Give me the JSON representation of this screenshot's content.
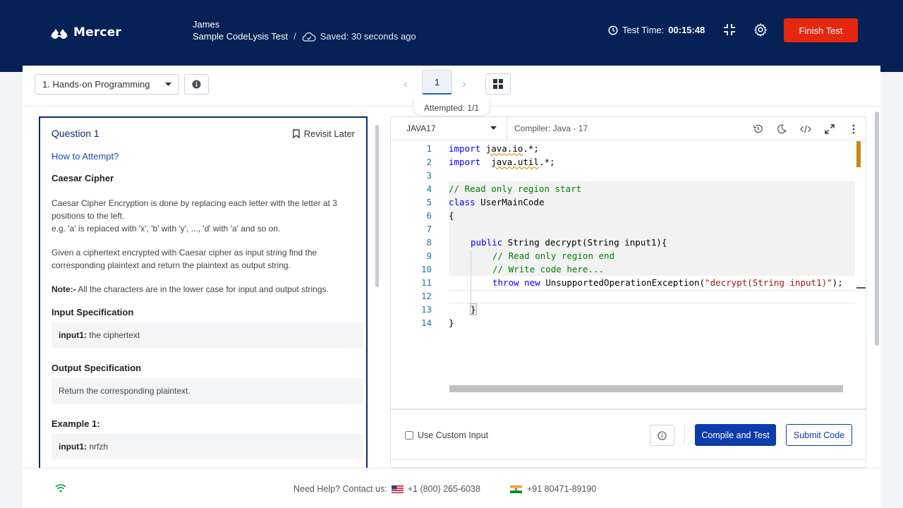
{
  "header": {
    "logo_text": "Mercer",
    "user_name": "James",
    "test_name": "Sample CodeLysis Test",
    "separator": "/",
    "saved_text": "Saved: 30 seconds ago",
    "timer_label": "Test Time:",
    "timer_value": "00:15:48",
    "finish_label": "Finish Test"
  },
  "navigation": {
    "section": "1. Hands-on Programming",
    "prev": "‹",
    "next": "›",
    "current_page": "1",
    "attempted": "Attempted: 1/1"
  },
  "question": {
    "title": "Question 1",
    "revisit_label": "Revisit Later",
    "how_to_attempt": "How to Attempt?",
    "name": "Caesar Cipher",
    "para1_line1": "Caesar Cipher Encryption is done by replacing each letter with the letter at 3 positions to the left.",
    "para1_line2": "e.g. 'a' is replaced with 'x', 'b' with 'y', ..., 'd' with 'a' and so on.",
    "para2": "Given a ciphertext encrypted with Caesar cipher as input string find the corresponding plaintext and return the plaintext as output string.",
    "note_label": "Note:-",
    "note_text": "  All the characters are in the lower case for input and output strings.",
    "input_spec_title": "Input Specification",
    "input_spec_key": "input1:",
    "input_spec_value": " the ciphertext",
    "output_spec_title": "Output Specification",
    "output_spec_value": "Return the corresponding plaintext.",
    "example_title": "Example 1:",
    "example_key": "input1:",
    "example_value": " nrfzh"
  },
  "editor": {
    "language": "JAVA17",
    "compiler": "Compiler: Java - 17",
    "line_numbers": [
      "1",
      "2",
      "3",
      "4",
      "5",
      "6",
      "7",
      "8",
      "9",
      "10",
      "11",
      "12",
      "13",
      "14"
    ],
    "code": {
      "l1_kw": "import",
      "l1_pkg": "java.io",
      "l1_rest": ".*;",
      "l2_kw": "import",
      "l2_pkg": "java.util",
      "l2_rest": ".*;",
      "l4": "// Read only region start",
      "l5_kw": "class",
      "l5_rest": " UserMainCode",
      "l6": "{",
      "l8_kw": "public",
      "l8_rest": " String decrypt(String input1){",
      "l9": "// Read only region end",
      "l10": "// Write code here...",
      "l11_kw1": "throw",
      "l11_kw2": "new",
      "l11_mid": " UnsupportedOperationException(",
      "l11_str": "\"decrypt(String input1)\"",
      "l11_end": ");",
      "l13": "}",
      "l14": "}"
    }
  },
  "actions": {
    "custom_input_label": "Use Custom Input",
    "compile_label": "Compile and Test",
    "submit_label": "Submit Code"
  },
  "footer": {
    "help_text": "Need Help? Contact us:",
    "phone_us": "+1 (800) 265-6038",
    "phone_in": "+91 80471-89190"
  },
  "colors": {
    "header_bg": "#062155",
    "finish_btn": "#e5270d",
    "primary": "#0b3ca8",
    "wifi": "#1f9d55"
  }
}
